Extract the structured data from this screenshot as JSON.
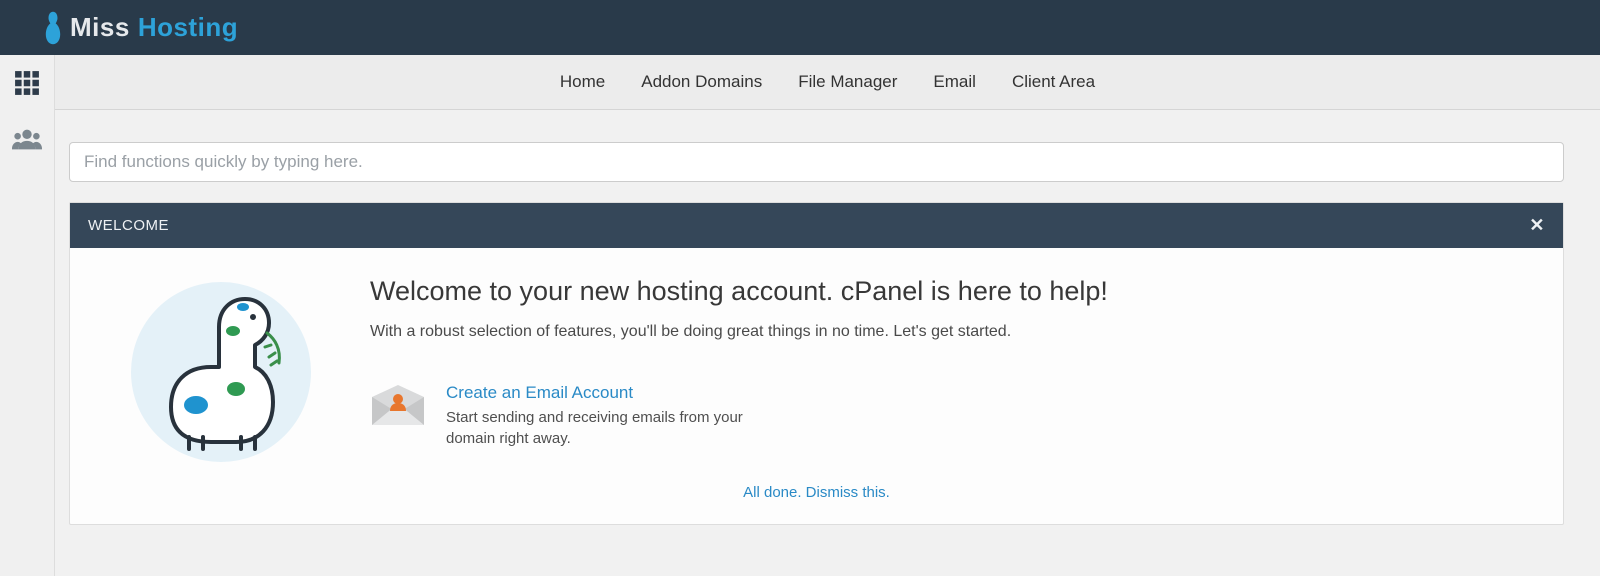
{
  "brand": {
    "part1": "Miss",
    "part2": "Hosting"
  },
  "nav": {
    "items": [
      {
        "label": "Home"
      },
      {
        "label": "Addon Domains"
      },
      {
        "label": "File Manager"
      },
      {
        "label": "Email"
      },
      {
        "label": "Client Area"
      }
    ]
  },
  "search": {
    "placeholder": "Find functions quickly by typing here."
  },
  "welcome": {
    "panel_title": "WELCOME",
    "heading": "Welcome to your new hosting account. cPanel is here to help!",
    "subtitle": "With a robust selection of features, you'll be doing great things in no time. Let's get started.",
    "action": {
      "link_label": "Create an Email Account",
      "description": "Start sending and receiving emails from your domain right away."
    },
    "dismiss_label": "All done. Dismiss this."
  }
}
